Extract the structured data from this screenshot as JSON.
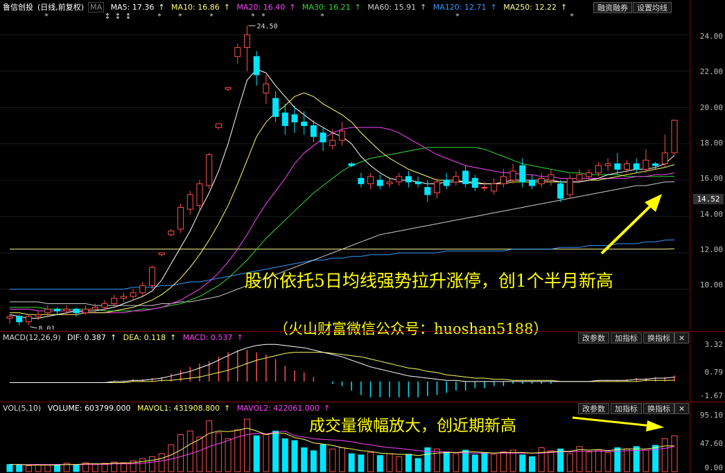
{
  "main_header": {
    "title": "鲁信创投",
    "period": "(日线,前复权)",
    "ma_label": "MA",
    "ma5": "MA5: 17.36",
    "ma10": "MA10: 16.86",
    "ma20": "MA20: 16.40",
    "ma30": "MA30: 16.21",
    "ma60": "MA60: 15.91",
    "ma120": "MA120: 12.71",
    "ma250": "MA250: 12.22",
    "btn_margin": "融资融券",
    "btn_settings": "设置均线"
  },
  "colors": {
    "up": "#ff4f4f",
    "down": "#00e5ff",
    "ma5": "#ffffff",
    "ma10": "#ffff66",
    "ma20": "#ff44ff",
    "ma30": "#33dd33",
    "ma60": "#cccccc",
    "ma120": "#3399ff",
    "ma250": "#ffff99",
    "annotation": "#ffff00"
  },
  "price_axis": [
    "24.00",
    "22.00",
    "20.00",
    "18.00",
    "16.00",
    "14.00",
    "12.00",
    "10.00"
  ],
  "current_price": "14.52",
  "high_label": "24.50",
  "low_label": "8.01",
  "annotation_main": "股价依托5日均线强势拉升涨停，创1个半月新高",
  "annotation_source": "（火山财富微信公众号：huoshan5188）",
  "macd_header": {
    "name": "MACD(12,26,9)",
    "dif": "DIF: 0.387",
    "dea": "DEA: 0.118",
    "macd": "MACD: 0.537",
    "btn_params": "改参数",
    "btn_add": "加指标",
    "btn_switch": "换指标",
    "btn_close": "✕"
  },
  "macd_axis": [
    "3.32",
    "0.79",
    "-1.67"
  ],
  "vol_header": {
    "name": "VOL(5,10)",
    "volume": "VOLUME: 603799.000",
    "mavol1": "MAVOL1: 431908.800",
    "mavol2": "MAVOL2: 422061.000",
    "btn_params": "改参数",
    "btn_add": "加指标",
    "btn_switch": "换指标",
    "btn_close": "✕"
  },
  "vol_axis": [
    "95.10",
    "47.60",
    "0.00"
  ],
  "annotation_volume": "成交量微幅放大，创近期新高",
  "chart_data": {
    "type": "candlestick",
    "price_ylim": [
      8,
      25
    ],
    "candles": [
      [
        8.4,
        8.5,
        8.1,
        8.6
      ],
      [
        8.5,
        8.2,
        8.0,
        8.6
      ],
      [
        8.2,
        8.5,
        8.01,
        8.6
      ],
      [
        8.5,
        8.6,
        8.3,
        8.8
      ],
      [
        8.7,
        8.9,
        8.5,
        9.1
      ],
      [
        8.9,
        8.8,
        8.6,
        9.0
      ],
      [
        8.8,
        8.9,
        8.6,
        9.1
      ],
      [
        8.9,
        8.7,
        8.5,
        9.0
      ],
      [
        8.7,
        8.9,
        8.6,
        9.1
      ],
      [
        8.9,
        9.0,
        8.7,
        9.2
      ],
      [
        9.0,
        9.2,
        8.8,
        9.4
      ],
      [
        9.2,
        9.5,
        9.0,
        9.7
      ],
      [
        9.5,
        9.6,
        9.3,
        9.8
      ],
      [
        9.6,
        9.8,
        9.4,
        10.0
      ],
      [
        9.8,
        10.2,
        9.6,
        10.4
      ],
      [
        10.2,
        11.2,
        10.0,
        11.3
      ],
      [
        11.9,
        12.0,
        11.8,
        12.0
      ],
      [
        13.0,
        13.2,
        12.9,
        13.3
      ],
      [
        13.3,
        14.5,
        13.1,
        14.7
      ],
      [
        14.4,
        15.2,
        14.1,
        15.4
      ],
      [
        14.6,
        15.8,
        14.3,
        16.0
      ],
      [
        15.7,
        17.4,
        15.5,
        17.5
      ],
      [
        18.9,
        19.1,
        18.8,
        19.1
      ],
      [
        21.0,
        21.1,
        20.9,
        21.1
      ],
      [
        22.8,
        23.3,
        22.4,
        23.5
      ],
      [
        23.3,
        24.0,
        22.0,
        24.5
      ],
      [
        22.8,
        21.8,
        21.2,
        23.1
      ],
      [
        20.8,
        21.3,
        20.2,
        21.8
      ],
      [
        20.5,
        19.5,
        19.2,
        20.9
      ],
      [
        19.7,
        19.0,
        18.5,
        20.2
      ],
      [
        19.6,
        19.2,
        18.6,
        20.1
      ],
      [
        19.2,
        19.0,
        18.5,
        19.8
      ],
      [
        19.0,
        18.4,
        18.1,
        19.3
      ],
      [
        18.6,
        18.1,
        17.6,
        18.9
      ],
      [
        17.9,
        18.2,
        17.7,
        18.8
      ],
      [
        18.2,
        18.7,
        17.9,
        19.2
      ],
      [
        16.9,
        16.8,
        16.7,
        17.0
      ],
      [
        16.1,
        15.8,
        15.6,
        16.4
      ],
      [
        15.8,
        16.2,
        15.5,
        16.4
      ],
      [
        16.0,
        15.7,
        15.5,
        16.3
      ],
      [
        15.8,
        15.9,
        15.6,
        16.2
      ],
      [
        15.9,
        16.2,
        15.7,
        16.4
      ],
      [
        16.2,
        15.9,
        15.6,
        16.5
      ],
      [
        15.9,
        15.8,
        15.6,
        16.2
      ],
      [
        15.6,
        15.2,
        14.8,
        16.0
      ],
      [
        15.3,
        15.9,
        15.0,
        16.1
      ],
      [
        16.0,
        15.7,
        15.5,
        16.4
      ],
      [
        15.9,
        16.2,
        15.7,
        16.5
      ],
      [
        16.5,
        15.8,
        15.6,
        16.8
      ],
      [
        16.1,
        15.6,
        15.4,
        16.3
      ],
      [
        15.6,
        15.6,
        15.4,
        15.9
      ],
      [
        15.4,
        15.8,
        15.2,
        16.1
      ],
      [
        15.8,
        16.2,
        15.6,
        16.6
      ],
      [
        16.0,
        16.5,
        15.8,
        16.9
      ],
      [
        16.8,
        15.9,
        15.6,
        17.2
      ],
      [
        16.0,
        15.7,
        15.5,
        16.3
      ],
      [
        15.8,
        16.1,
        15.6,
        16.4
      ],
      [
        16.0,
        16.3,
        15.7,
        16.6
      ],
      [
        15.8,
        15.0,
        14.8,
        16.0
      ],
      [
        15.2,
        16.1,
        15.0,
        16.3
      ],
      [
        16.0,
        16.3,
        15.9,
        16.6
      ],
      [
        16.2,
        16.4,
        16.0,
        16.6
      ],
      [
        16.4,
        16.8,
        16.2,
        17.0
      ],
      [
        16.8,
        16.9,
        16.5,
        17.2
      ],
      [
        16.9,
        16.6,
        16.3,
        17.5
      ],
      [
        16.6,
        16.9,
        16.4,
        17.1
      ],
      [
        16.9,
        16.6,
        16.4,
        17.2
      ],
      [
        16.6,
        17.1,
        16.4,
        17.7
      ],
      [
        16.9,
        16.8,
        16.6,
        17.0
      ],
      [
        16.9,
        17.5,
        16.7,
        18.5
      ],
      [
        17.5,
        19.3,
        17.4,
        19.3
      ]
    ],
    "ma_series": {
      "ma5": [
        8.6,
        8.5,
        8.4,
        8.4,
        8.5,
        8.6,
        8.7,
        8.8,
        8.8,
        8.8,
        8.9,
        9.0,
        9.2,
        9.4,
        9.6,
        9.9,
        10.5,
        11.4,
        12.3,
        13.2,
        14.3,
        15.3,
        16.5,
        18.0,
        19.8,
        21.5,
        22.1,
        21.9,
        21.2,
        20.6,
        20.0,
        19.6,
        19.2,
        18.9,
        18.6,
        18.4,
        18.0,
        17.3,
        16.8,
        16.4,
        16.1,
        16.0,
        16.0,
        15.9,
        15.8,
        15.8,
        15.9,
        15.9,
        15.9,
        15.8,
        15.8,
        15.8,
        15.9,
        16.0,
        16.0,
        16.0,
        16.0,
        16.0,
        15.9,
        15.9,
        15.9,
        16.0,
        16.1,
        16.3,
        16.4,
        16.5,
        16.6,
        16.6,
        16.7,
        16.9,
        17.36
      ],
      "ma10": [
        8.7,
        8.7,
        8.6,
        8.6,
        8.6,
        8.6,
        8.6,
        8.6,
        8.7,
        8.7,
        8.7,
        8.8,
        8.9,
        9.0,
        9.2,
        9.4,
        9.7,
        10.1,
        10.6,
        11.2,
        11.9,
        12.7,
        13.6,
        14.6,
        15.8,
        17.1,
        18.4,
        19.2,
        19.7,
        20.1,
        20.6,
        20.8,
        20.6,
        20.2,
        19.9,
        19.6,
        19.2,
        18.6,
        18.1,
        17.6,
        17.2,
        16.9,
        16.6,
        16.4,
        16.2,
        16.0,
        16.0,
        16.0,
        15.9,
        15.9,
        15.8,
        15.8,
        15.8,
        15.9,
        15.9,
        15.9,
        15.9,
        15.9,
        15.9,
        15.9,
        15.9,
        16.0,
        16.0,
        16.1,
        16.2,
        16.3,
        16.4,
        16.5,
        16.6,
        16.7,
        16.86
      ],
      "ma20": [
        8.9,
        8.9,
        8.9,
        8.8,
        8.8,
        8.8,
        8.8,
        8.8,
        8.7,
        8.7,
        8.7,
        8.7,
        8.7,
        8.8,
        8.8,
        8.9,
        9.0,
        9.2,
        9.4,
        9.7,
        10.0,
        10.4,
        10.9,
        11.5,
        12.2,
        13.0,
        13.9,
        14.7,
        15.4,
        16.1,
        16.9,
        17.5,
        17.9,
        18.3,
        18.6,
        18.8,
        18.9,
        18.9,
        18.9,
        18.9,
        18.8,
        18.6,
        18.3,
        18.0,
        17.7,
        17.4,
        17.2,
        17.0,
        16.8,
        16.7,
        16.6,
        16.5,
        16.4,
        16.4,
        16.3,
        16.3,
        16.2,
        16.2,
        16.1,
        16.1,
        16.1,
        16.1,
        16.1,
        16.1,
        16.1,
        16.1,
        16.2,
        16.2,
        16.3,
        16.3,
        16.4
      ],
      "ma30": [
        9.0,
        9.0,
        9.0,
        9.0,
        8.9,
        8.9,
        8.9,
        8.9,
        8.9,
        8.9,
        8.8,
        8.8,
        8.8,
        8.8,
        8.9,
        8.9,
        9.0,
        9.1,
        9.2,
        9.4,
        9.6,
        9.9,
        10.2,
        10.6,
        11.1,
        11.6,
        12.2,
        12.8,
        13.3,
        13.8,
        14.3,
        14.8,
        15.3,
        15.7,
        16.1,
        16.5,
        16.8,
        17.0,
        17.2,
        17.3,
        17.4,
        17.5,
        17.6,
        17.7,
        17.8,
        17.8,
        17.8,
        17.8,
        17.8,
        17.8,
        17.7,
        17.5,
        17.3,
        17.1,
        16.9,
        16.8,
        16.7,
        16.6,
        16.5,
        16.4,
        16.4,
        16.3,
        16.3,
        16.3,
        16.3,
        16.2,
        16.2,
        16.2,
        16.2,
        16.2,
        16.21
      ],
      "ma60": [
        9.3,
        9.3,
        9.3,
        9.3,
        9.2,
        9.2,
        9.2,
        9.2,
        9.2,
        9.1,
        9.1,
        9.1,
        9.1,
        9.1,
        9.1,
        9.1,
        9.2,
        9.2,
        9.3,
        9.3,
        9.4,
        9.5,
        9.6,
        9.8,
        10.0,
        10.2,
        10.4,
        10.6,
        10.8,
        11.0,
        11.2,
        11.4,
        11.6,
        11.8,
        12.0,
        12.2,
        12.4,
        12.6,
        12.8,
        13.0,
        13.1,
        13.2,
        13.3,
        13.4,
        13.5,
        13.6,
        13.7,
        13.8,
        13.9,
        14.0,
        14.1,
        14.2,
        14.3,
        14.4,
        14.5,
        14.6,
        14.7,
        14.8,
        14.9,
        15.0,
        15.1,
        15.2,
        15.3,
        15.4,
        15.5,
        15.6,
        15.7,
        15.7,
        15.8,
        15.9,
        15.91
      ],
      "ma120": [
        10.0,
        10.0,
        10.0,
        10.0,
        10.0,
        10.0,
        10.0,
        10.0,
        10.0,
        10.0,
        10.0,
        10.0,
        10.0,
        10.1,
        10.1,
        10.1,
        10.2,
        10.2,
        10.3,
        10.4,
        10.4,
        10.5,
        10.6,
        10.7,
        10.8,
        10.9,
        11.0,
        11.1,
        11.2,
        11.3,
        11.4,
        11.5,
        11.6,
        11.6,
        11.7,
        11.7,
        11.8,
        11.8,
        11.9,
        11.9,
        11.9,
        12.0,
        12.0,
        12.0,
        12.0,
        12.0,
        12.1,
        12.1,
        12.1,
        12.1,
        12.1,
        12.1,
        12.1,
        12.2,
        12.2,
        12.2,
        12.2,
        12.2,
        12.3,
        12.3,
        12.3,
        12.4,
        12.4,
        12.4,
        12.5,
        12.5,
        12.5,
        12.6,
        12.6,
        12.7,
        12.71
      ],
      "ma250": [
        12.2,
        12.2,
        12.2,
        12.2,
        12.2,
        12.2,
        12.2,
        12.2,
        12.2,
        12.2,
        12.2,
        12.2,
        12.2,
        12.2,
        12.2,
        12.2,
        12.2,
        12.2,
        12.2,
        12.2,
        12.2,
        12.2,
        12.2,
        12.2,
        12.2,
        12.2,
        12.2,
        12.2,
        12.2,
        12.2,
        12.2,
        12.2,
        12.2,
        12.2,
        12.2,
        12.2,
        12.2,
        12.2,
        12.2,
        12.2,
        12.2,
        12.2,
        12.2,
        12.2,
        12.2,
        12.2,
        12.2,
        12.2,
        12.2,
        12.2,
        12.2,
        12.2,
        12.2,
        12.2,
        12.2,
        12.2,
        12.2,
        12.2,
        12.2,
        12.2,
        12.2,
        12.2,
        12.2,
        12.2,
        12.2,
        12.2,
        12.2,
        12.2,
        12.2,
        12.2,
        12.22
      ]
    },
    "macd_ylim": [
      -1.67,
      3.32
    ],
    "macd_dif": [
      -0.1,
      -0.1,
      -0.1,
      -0.1,
      -0.1,
      -0.1,
      -0.1,
      -0.1,
      -0.1,
      -0.1,
      -0.1,
      0.0,
      0.0,
      0.1,
      0.1,
      0.2,
      0.3,
      0.5,
      0.7,
      0.9,
      1.2,
      1.5,
      1.9,
      2.3,
      2.7,
      3.0,
      3.2,
      3.3,
      3.3,
      3.2,
      3.1,
      3.0,
      2.8,
      2.6,
      2.4,
      2.2,
      1.9,
      1.6,
      1.3,
      1.1,
      0.9,
      0.7,
      0.5,
      0.4,
      0.3,
      0.2,
      0.1,
      0.1,
      0.0,
      0.0,
      0.0,
      0.0,
      0.0,
      0.0,
      0.0,
      0.0,
      0.0,
      0.0,
      0.0,
      0.0,
      0.0,
      0.0,
      0.1,
      0.1,
      0.1,
      0.1,
      0.2,
      0.2,
      0.3,
      0.3,
      0.387
    ],
    "macd_dea": [
      -0.1,
      -0.1,
      -0.1,
      -0.1,
      -0.1,
      -0.1,
      -0.1,
      -0.1,
      -0.1,
      -0.1,
      -0.1,
      -0.1,
      -0.1,
      0.0,
      0.0,
      0.0,
      0.1,
      0.1,
      0.2,
      0.3,
      0.4,
      0.6,
      0.8,
      1.0,
      1.3,
      1.6,
      1.9,
      2.1,
      2.3,
      2.5,
      2.6,
      2.6,
      2.6,
      2.6,
      2.5,
      2.4,
      2.3,
      2.2,
      2.0,
      1.8,
      1.6,
      1.4,
      1.2,
      1.1,
      0.9,
      0.8,
      0.6,
      0.5,
      0.4,
      0.3,
      0.3,
      0.2,
      0.2,
      0.1,
      0.1,
      0.1,
      0.1,
      0.1,
      0.0,
      0.0,
      0.0,
      0.0,
      0.0,
      0.0,
      0.0,
      0.0,
      0.0,
      0.1,
      0.1,
      0.1,
      0.118
    ],
    "macd_bar": [
      0,
      0,
      0,
      0,
      0,
      0,
      0,
      0,
      0,
      0,
      0,
      0.1,
      0.1,
      0.2,
      0.2,
      0.3,
      0.4,
      0.7,
      1.0,
      1.3,
      1.6,
      1.8,
      2.2,
      2.6,
      2.8,
      2.8,
      2.6,
      2.4,
      2.0,
      1.4,
      1.0,
      0.8,
      0.4,
      0,
      -0.2,
      -0.4,
      -0.8,
      -1.2,
      -1.4,
      -1.4,
      -1.4,
      -1.4,
      -1.4,
      -1.4,
      -1.3,
      -1.2,
      -1.0,
      -0.8,
      -0.8,
      -0.6,
      -0.6,
      -0.4,
      -0.4,
      -0.2,
      -0.2,
      -0.2,
      -0.2,
      -0.2,
      0,
      0,
      0,
      0,
      0.1,
      0.1,
      0.1,
      0.2,
      0.3,
      0.3,
      0.4,
      0.4,
      0.537
    ],
    "vol_ylim": [
      0,
      95.1
    ],
    "volume": [
      12,
      11,
      10,
      12,
      11,
      12,
      14,
      11,
      15,
      13,
      14,
      16,
      15,
      18,
      22,
      25,
      30,
      45,
      62,
      68,
      58,
      85,
      65,
      55,
      70,
      88,
      60,
      62,
      68,
      55,
      52,
      40,
      35,
      45,
      38,
      40,
      30,
      28,
      32,
      27,
      30,
      25,
      29,
      22,
      40,
      38,
      33,
      30,
      36,
      28,
      32,
      29,
      33,
      36,
      28,
      25,
      40,
      35,
      38,
      30,
      42,
      33,
      36,
      32,
      40,
      38,
      42,
      36,
      44,
      55,
      60
    ],
    "volume_up": [
      0,
      0,
      1,
      1,
      1,
      0,
      1,
      0,
      1,
      1,
      1,
      1,
      1,
      1,
      1,
      1,
      1,
      1,
      1,
      1,
      1,
      1,
      1,
      1,
      1,
      1,
      0,
      1,
      0,
      0,
      0,
      0,
      0,
      0,
      1,
      1,
      0,
      0,
      1,
      0,
      1,
      1,
      0,
      0,
      0,
      1,
      0,
      1,
      0,
      0,
      0,
      1,
      1,
      1,
      0,
      0,
      1,
      1,
      0,
      1,
      1,
      1,
      1,
      1,
      0,
      1,
      0,
      1,
      0,
      1,
      1
    ],
    "mavol1": [
      12,
      12,
      11,
      11,
      11,
      11,
      12,
      12,
      13,
      13,
      13,
      14,
      14,
      15,
      17,
      19,
      22,
      28,
      36,
      46,
      54,
      64,
      68,
      67,
      69,
      73,
      68,
      62,
      65,
      64,
      57,
      54,
      48,
      46,
      44,
      40,
      38,
      35,
      34,
      31,
      30,
      29,
      29,
      27,
      29,
      31,
      32,
      32,
      33,
      33,
      32,
      31,
      32,
      32,
      32,
      31,
      32,
      33,
      34,
      34,
      37,
      36,
      37,
      35,
      37,
      38,
      38,
      38,
      40,
      43,
      43
    ],
    "mavol2": [
      12,
      12,
      12,
      12,
      12,
      12,
      12,
      12,
      12,
      12,
      12,
      13,
      13,
      13,
      14,
      16,
      18,
      21,
      25,
      30,
      35,
      42,
      47,
      52,
      58,
      62,
      64,
      63,
      66,
      68,
      60,
      58,
      55,
      54,
      53,
      52,
      50,
      47,
      45,
      42,
      40,
      39,
      37,
      35,
      34,
      34,
      33,
      32,
      31,
      31,
      31,
      31,
      31,
      31,
      31,
      31,
      31,
      32,
      33,
      33,
      34,
      34,
      34,
      34,
      34,
      35,
      35,
      36,
      37,
      39,
      42
    ]
  }
}
